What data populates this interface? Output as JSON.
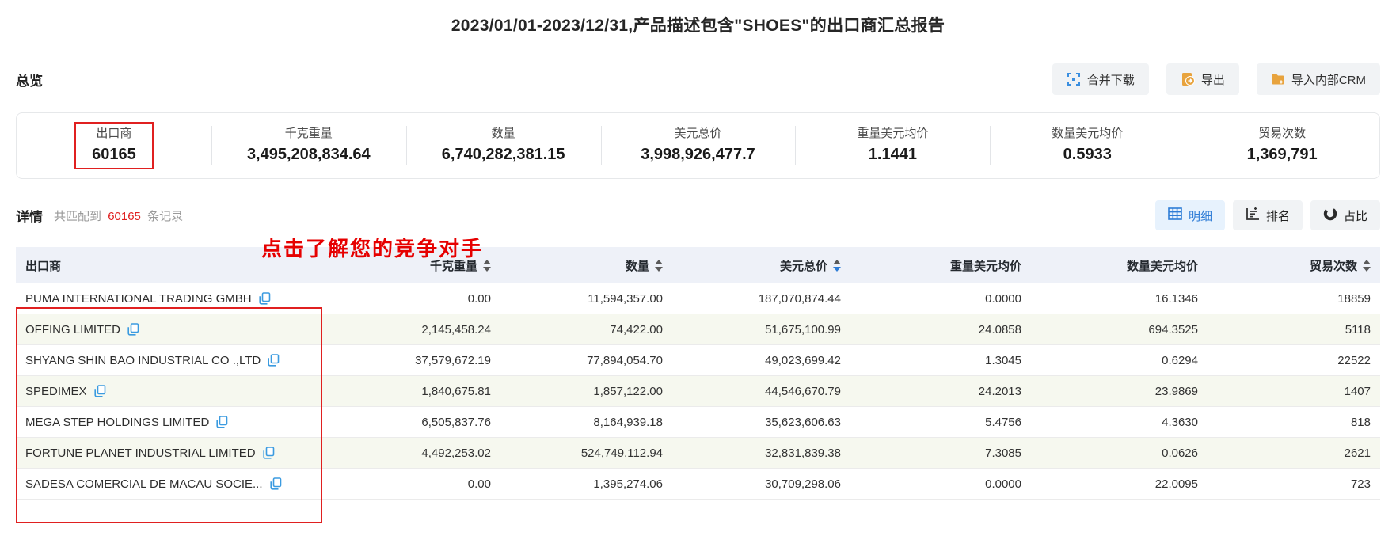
{
  "title": "2023/01/01-2023/12/31,产品描述包含\"SHOES\"的出口商汇总报告",
  "toolbar": {
    "overview_label": "总览",
    "buttons": [
      {
        "label": "合并下载",
        "icon": "merge-download-icon"
      },
      {
        "label": "导出",
        "icon": "export-icon"
      },
      {
        "label": "导入内部CRM",
        "icon": "import-crm-icon"
      }
    ]
  },
  "stats": [
    {
      "label": "出口商",
      "value": "60165",
      "highlighted": true
    },
    {
      "label": "千克重量",
      "value": "3,495,208,834.64"
    },
    {
      "label": "数量",
      "value": "6,740,282,381.15"
    },
    {
      "label": "美元总价",
      "value": "3,998,926,477.7"
    },
    {
      "label": "重量美元均价",
      "value": "1.1441"
    },
    {
      "label": "数量美元均价",
      "value": "0.5933"
    },
    {
      "label": "贸易次数",
      "value": "1,369,791"
    }
  ],
  "details": {
    "label": "详情",
    "match_prefix": "共匹配到",
    "match_count": "60165",
    "match_suffix": "条记录",
    "annotation": "点击了解您的竞争对手",
    "tabs": [
      {
        "label": "明细",
        "icon": "table-grid-icon",
        "active": true
      },
      {
        "label": "排名",
        "icon": "ranking-icon",
        "active": false
      },
      {
        "label": "占比",
        "icon": "donut-chart-icon",
        "active": false
      }
    ]
  },
  "table": {
    "columns": [
      {
        "label": "出口商",
        "sortable": false,
        "align": "left"
      },
      {
        "label": "千克重量",
        "sortable": true,
        "sort": "none"
      },
      {
        "label": "数量",
        "sortable": true,
        "sort": "none"
      },
      {
        "label": "美元总价",
        "sortable": true,
        "sort": "desc"
      },
      {
        "label": "重量美元均价",
        "sortable": false
      },
      {
        "label": "数量美元均价",
        "sortable": false
      },
      {
        "label": "贸易次数",
        "sortable": true,
        "sort": "none"
      }
    ],
    "rows": [
      {
        "name": "PUMA INTERNATIONAL TRADING GMBH",
        "values": [
          "0.00",
          "11,594,357.00",
          "187,070,874.44",
          "0.0000",
          "16.1346",
          "18859"
        ]
      },
      {
        "name": "OFFING LIMITED",
        "values": [
          "2,145,458.24",
          "74,422.00",
          "51,675,100.99",
          "24.0858",
          "694.3525",
          "5118"
        ]
      },
      {
        "name": "SHYANG SHIN BAO INDUSTRIAL CO .,LTD",
        "values": [
          "37,579,672.19",
          "77,894,054.70",
          "49,023,699.42",
          "1.3045",
          "0.6294",
          "22522"
        ]
      },
      {
        "name": "SPEDIMEX",
        "values": [
          "1,840,675.81",
          "1,857,122.00",
          "44,546,670.79",
          "24.2013",
          "23.9869",
          "1407"
        ]
      },
      {
        "name": "MEGA STEP HOLDINGS LIMITED",
        "values": [
          "6,505,837.76",
          "8,164,939.18",
          "35,623,606.63",
          "5.4756",
          "4.3630",
          "818"
        ]
      },
      {
        "name": "FORTUNE PLANET INDUSTRIAL LIMITED",
        "values": [
          "4,492,253.02",
          "524,749,112.94",
          "32,831,839.38",
          "7.3085",
          "0.0626",
          "2621"
        ]
      },
      {
        "name": "SADESA COMERCIAL DE MACAU SOCIE...",
        "values": [
          "0.00",
          "1,395,274.06",
          "30,709,298.06",
          "0.0000",
          "22.0095",
          "723"
        ]
      }
    ]
  },
  "colors": {
    "accent_blue": "#2e7cd6",
    "highlight_red": "#e02020",
    "annotation_red": "#e60000",
    "icon_orange": "#e8a33d",
    "icon_blue": "#3b8fe0",
    "header_bg": "#eef1f8",
    "stripe_bg": "#f6f8ef"
  }
}
